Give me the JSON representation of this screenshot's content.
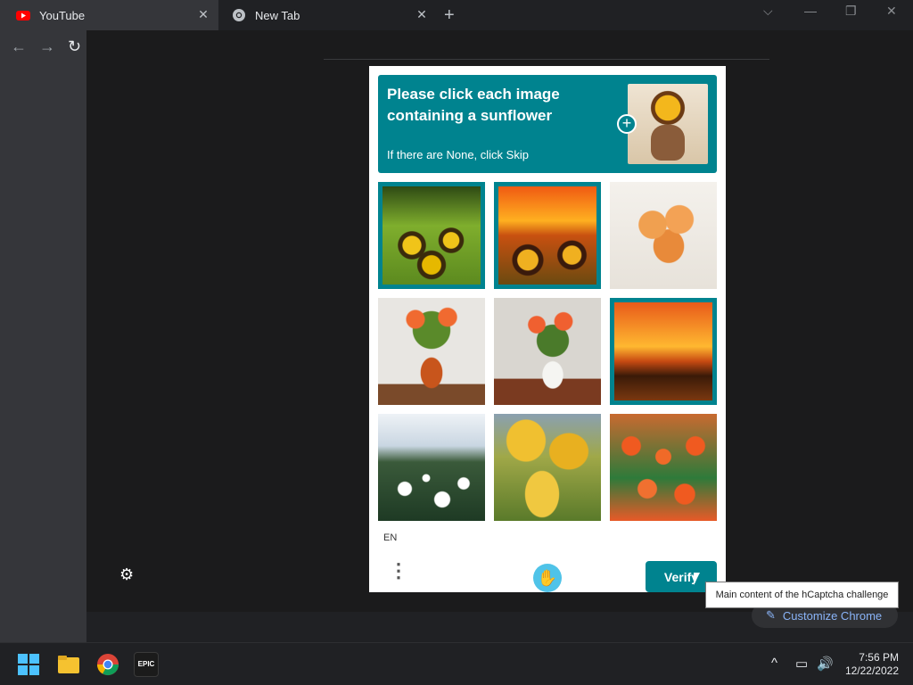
{
  "browser": {
    "tabs": [
      {
        "label": "YouTube",
        "close": "✕"
      },
      {
        "label": "New Tab",
        "close": "✕"
      }
    ],
    "new_tab": "+",
    "controls": {
      "dropdown": "⌵",
      "minimize": "—",
      "restore": "❐",
      "close": "✕"
    },
    "nav": {
      "back": "←",
      "forward": "→",
      "reload": "↻"
    }
  },
  "captcha": {
    "prompt": "Please click each image containing a sunflower",
    "sub": "If there are None, click Skip",
    "plus": "+",
    "language": "EN",
    "menu_icon": "⋮",
    "verify_label": "Verify",
    "tooltip": "Main content of the hCaptcha challenge",
    "images": [
      {
        "subject": "sunflower-field",
        "selected": true
      },
      {
        "subject": "sunflowers-sunset",
        "selected": true
      },
      {
        "subject": "tulips-bouquet",
        "selected": false
      },
      {
        "subject": "tulips-vase-orange",
        "selected": false
      },
      {
        "subject": "tulips-vase-white",
        "selected": false
      },
      {
        "subject": "sunset-field",
        "selected": true
      },
      {
        "subject": "daisy-field",
        "selected": false
      },
      {
        "subject": "yellow-tulips",
        "selected": false
      },
      {
        "subject": "orange-tulip-field",
        "selected": false
      }
    ]
  },
  "page": {
    "customize_label": "Customize Chrome",
    "gear_icon": "⚙"
  },
  "taskbar": {
    "time": "7:56 PM",
    "date": "12/22/2022",
    "icons": [
      "windows-start-icon",
      "file-explorer-icon",
      "chrome-icon",
      "epic-games-icon"
    ],
    "epic_label": "EPIC"
  },
  "colors": {
    "accent": "#00838f",
    "tooltip_bg": "#ffffff",
    "customize_text": "#8ab4f8"
  }
}
